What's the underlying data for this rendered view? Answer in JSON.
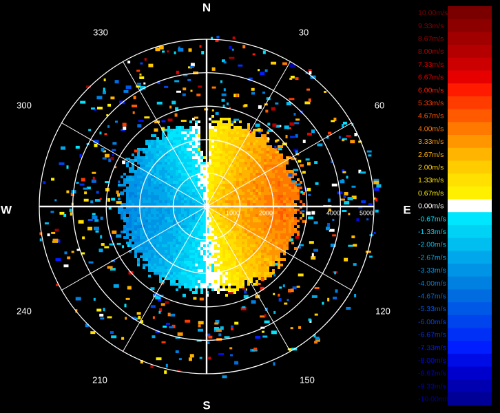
{
  "chart_data": {
    "type": "heatmap",
    "subtype": "polar-doppler-radial-velocity-ppi",
    "compass": {
      "north": "N",
      "east": "E",
      "south": "S",
      "west": "W"
    },
    "azimuth_labels": [
      "30",
      "60",
      "120",
      "150",
      "210",
      "240",
      "300",
      "330"
    ],
    "range_labels": [
      "1000",
      "2000",
      "4000",
      "5000"
    ],
    "range_rings": [
      1000,
      2000,
      3000,
      4000,
      5000
    ],
    "range_max": 5000,
    "radial_spokes_deg": 30,
    "velocity_range": [
      -10.0,
      10.0
    ],
    "velocity_field": {
      "description_of_pattern": "dipole",
      "echo_radius_northwest_to_south": 2550,
      "echo_radius_east": 2800,
      "positive_sector_center_deg": 85,
      "max_receding": 4.0,
      "max_approaching": -3.5
    },
    "legend": {
      "position": "right",
      "entries": [
        {
          "label": "10.00m/s",
          "color": "#7a0000"
        },
        {
          "label": "9.33m/s",
          "color": "#8c0000"
        },
        {
          "label": "8.67m/s",
          "color": "#a00000"
        },
        {
          "label": "8.00m/s",
          "color": "#b40000"
        },
        {
          "label": "7.33m/s",
          "color": "#cc0000"
        },
        {
          "label": "6.67m/s",
          "color": "#e60000"
        },
        {
          "label": "6.00m/s",
          "color": "#ff1a00"
        },
        {
          "label": "5.33m/s",
          "color": "#ff3c00"
        },
        {
          "label": "4.67m/s",
          "color": "#ff5a00"
        },
        {
          "label": "4.00m/s",
          "color": "#ff7800"
        },
        {
          "label": "3.33m/s",
          "color": "#ff9600"
        },
        {
          "label": "2.67m/s",
          "color": "#ffb400"
        },
        {
          "label": "2.00m/s",
          "color": "#ffcc00"
        },
        {
          "label": "1.33m/s",
          "color": "#ffe000"
        },
        {
          "label": "0.67m/s",
          "color": "#fff000"
        },
        {
          "label": "0.00m/s",
          "color": "#ffffff"
        },
        {
          "label": "-0.67m/s",
          "color": "#00e6ff"
        },
        {
          "label": "-1.33m/s",
          "color": "#00d2f5"
        },
        {
          "label": "-2.00m/s",
          "color": "#00bef0"
        },
        {
          "label": "-2.67m/s",
          "color": "#00a8eb"
        },
        {
          "label": "-3.33m/s",
          "color": "#0094e6"
        },
        {
          "label": "-4.00m/s",
          "color": "#0080e1"
        },
        {
          "label": "-4.67m/s",
          "color": "#006ce0"
        },
        {
          "label": "-5.33m/s",
          "color": "#0058e6"
        },
        {
          "label": "-6.00m/s",
          "color": "#0044ee"
        },
        {
          "label": "-6.67m/s",
          "color": "#0030f6"
        },
        {
          "label": "-7.33m/s",
          "color": "#001eff"
        },
        {
          "label": "-8.00m/s",
          "color": "#000ce6"
        },
        {
          "label": "-8.67m/s",
          "color": "#0000cc"
        },
        {
          "label": "-9.33m/s",
          "color": "#0000b0"
        },
        {
          "label": "-10.00m/s",
          "color": "#000096"
        }
      ]
    },
    "grid": true
  },
  "colors": {
    "background": "#000000",
    "grid_lines": "#ffffff",
    "axis_text": "#ffffff"
  }
}
